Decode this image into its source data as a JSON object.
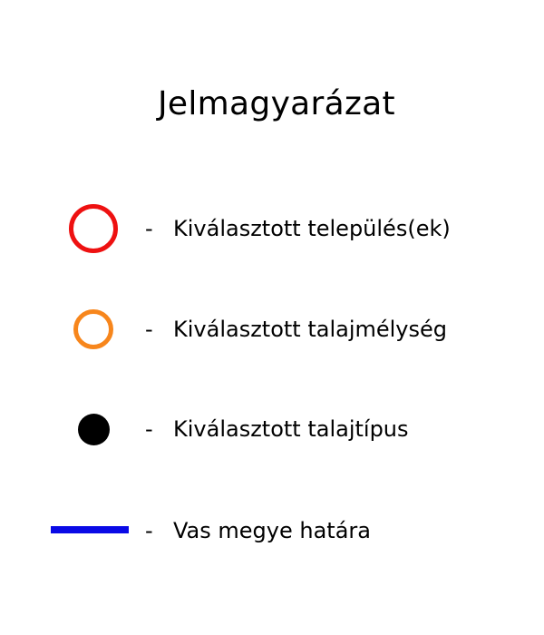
{
  "legend": {
    "title": "Jelmagyarázat",
    "items": [
      {
        "symbol": "red-ring",
        "color": "#ee1111",
        "separator": "-",
        "label": "Kiválasztott település(ek)"
      },
      {
        "symbol": "orange-ring",
        "color": "#f7861c",
        "separator": "-",
        "label": "Kiválasztott talajmélység"
      },
      {
        "symbol": "black-dot",
        "color": "#000000",
        "separator": "-",
        "label": "Kiválasztott talajtípus"
      },
      {
        "symbol": "blue-line",
        "color": "#0a0ae6",
        "separator": "-",
        "label": "Vas megye határa"
      }
    ]
  }
}
